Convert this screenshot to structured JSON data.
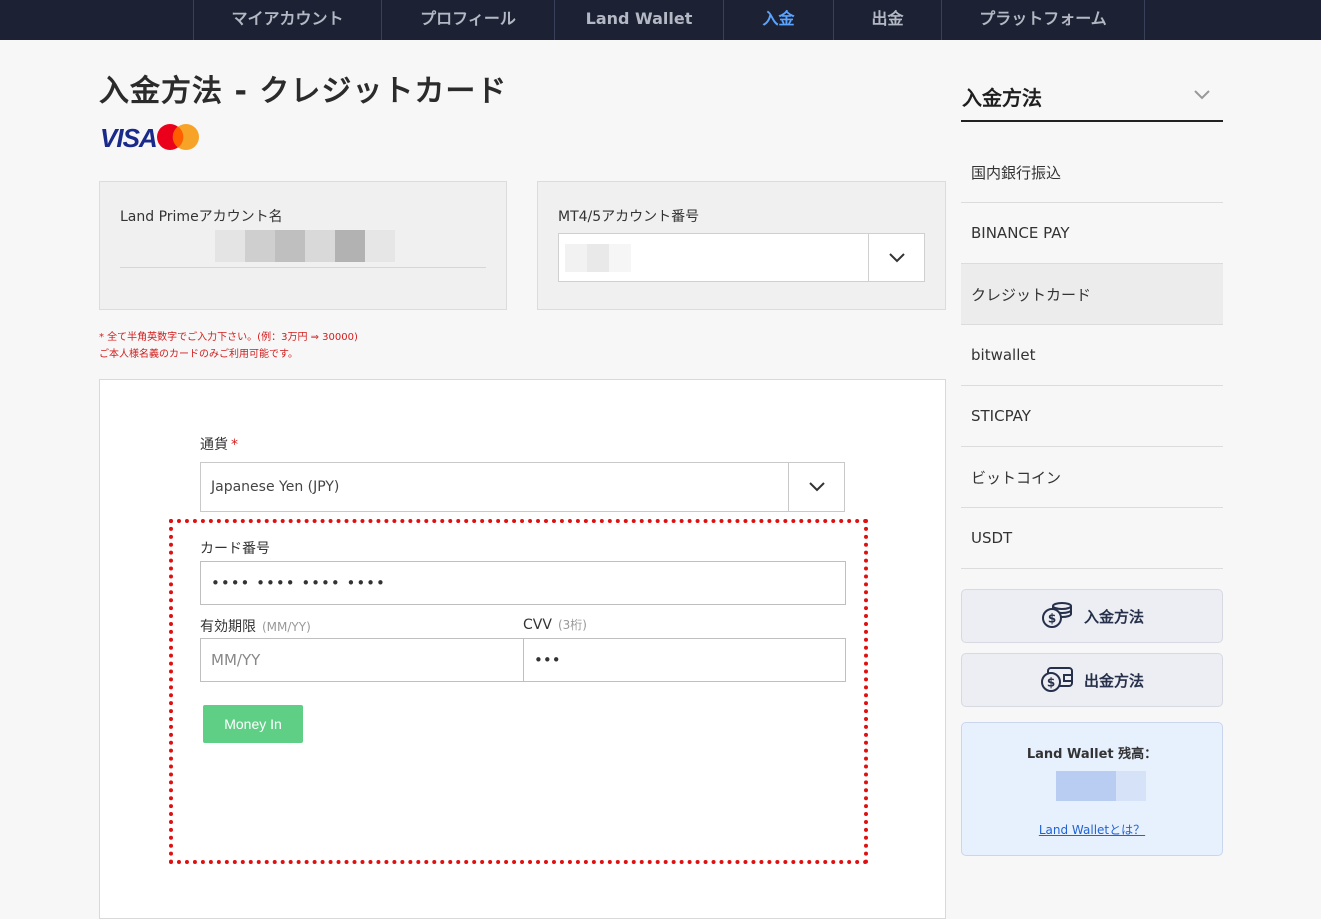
{
  "nav": {
    "tabs": [
      {
        "label": "マイアカウント"
      },
      {
        "label": "プロフィール"
      },
      {
        "label": "Land Wallet"
      },
      {
        "label": "入金",
        "active": true
      },
      {
        "label": "出金"
      },
      {
        "label": "プラットフォーム"
      }
    ]
  },
  "page": {
    "title": "入金方法 - クレジットカード",
    "logo_text": "VISA"
  },
  "account": {
    "name_label": "Land Primeアカウント名",
    "mt_label": "MT4/5アカウント番号"
  },
  "notes": {
    "line1": "* 全て半角英数字でご入力下さい。(例：3万円 ⇒ 30000)",
    "line2": "ご本人様名義のカードのみご利用可能です。"
  },
  "form": {
    "currency_label": "通貨",
    "required_mark": "*",
    "currency_value": "Japanese Yen (JPY)",
    "card_label": "カード番号",
    "card_value": "•••• •••• •••• ••••",
    "expiry_label": "有効期限",
    "expiry_hint": "(MM/YY)",
    "expiry_placeholder": "MM/YY",
    "cvv_label": "CVV",
    "cvv_hint": "(3桁)",
    "cvv_value": "•••",
    "submit_label": "Money In"
  },
  "sidebar": {
    "title": "入金方法",
    "items": [
      {
        "label": "国内銀行振込"
      },
      {
        "label": "BINANCE PAY"
      },
      {
        "label": "クレジットカード",
        "active": true
      },
      {
        "label": "bitwallet"
      },
      {
        "label": "STICPAY"
      },
      {
        "label": "ビットコイン"
      },
      {
        "label": "USDT"
      }
    ],
    "deposit_button": "入金方法",
    "withdraw_button": "出金方法",
    "wallet_title": "Land Wallet 残高：",
    "wallet_link": "Land Walletとは？"
  },
  "colors": {
    "nav_bg": "#1c2233",
    "nav_active": "#5aa3ff",
    "submit_green": "#5fcf86",
    "highlight_red": "#e01010",
    "link_blue": "#1f63d6"
  }
}
